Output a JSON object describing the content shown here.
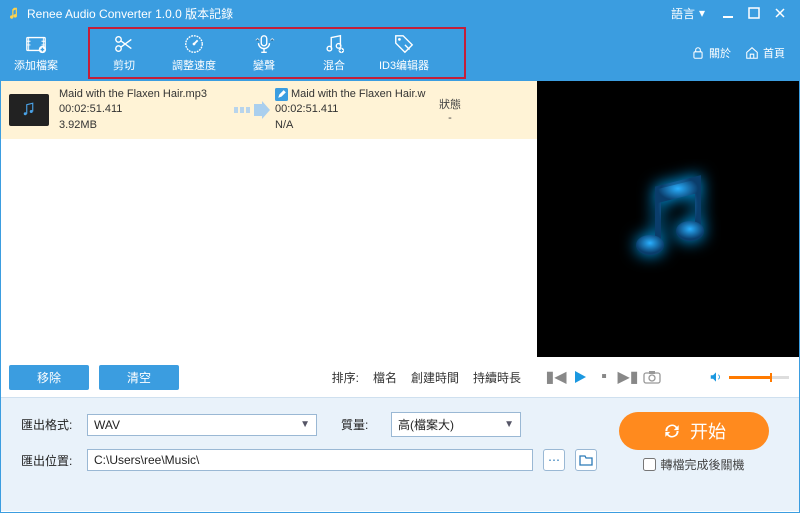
{
  "titlebar": {
    "app_title": "Renee Audio Converter 1.0.0 版本記錄",
    "language_label": "語言"
  },
  "toolbar": {
    "add_file": "添加檔案",
    "cut": "剪切",
    "adjust_speed": "調整速度",
    "change_voice": "變聲",
    "mix": "混合",
    "id3_editor": "ID3编辑器",
    "about": "關於",
    "home": "首頁"
  },
  "file": {
    "source_name": "Maid with the Flaxen Hair.mp3",
    "duration": "00:02:51.411",
    "filesize": "3.92MB",
    "out_name": "Maid with the Flaxen Hair.w",
    "out_duration": "00:02:51.411",
    "out_size": "N/A",
    "status_header": "狀態",
    "status_value": "-"
  },
  "buttons": {
    "remove": "移除",
    "clear": "清空"
  },
  "sort": {
    "label": "排序:",
    "by_name": "檔名",
    "by_created": "創建時間",
    "by_duration": "持續時長"
  },
  "export": {
    "format_label": "匯出格式:",
    "format_value": "WAV",
    "quality_label": "質量:",
    "quality_value": "高(檔案大)",
    "location_label": "匯出位置:",
    "location_value": "C:\\Users\\ree\\Music\\"
  },
  "start": {
    "label": "开始",
    "shutdown_checkbox": "轉檔完成後關機"
  }
}
